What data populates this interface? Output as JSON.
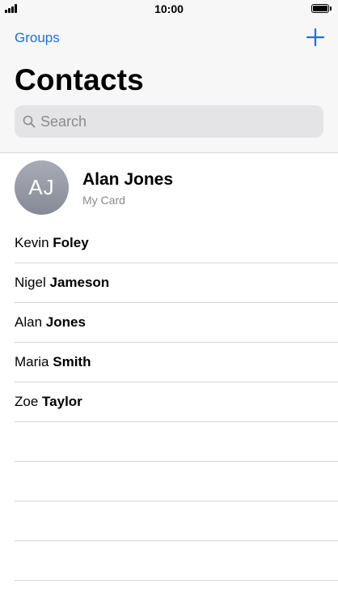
{
  "status_bar": {
    "time": "10:00"
  },
  "nav": {
    "groups_label": "Groups",
    "add_icon": "plus-icon"
  },
  "title": "Contacts",
  "search": {
    "placeholder": "Search",
    "icon": "magnifier-icon"
  },
  "my_card": {
    "initials": "AJ",
    "name": "Alan Jones",
    "subtitle": "My Card"
  },
  "contacts": [
    {
      "first": "Kevin",
      "last": "Foley"
    },
    {
      "first": "Nigel",
      "last": "Jameson"
    },
    {
      "first": "Alan",
      "last": "Jones"
    },
    {
      "first": "Maria",
      "last": "Smith"
    },
    {
      "first": "Zoe",
      "last": "Taylor"
    }
  ],
  "colors": {
    "accent": "#1a6fe0",
    "header_bg": "#f7f7f7",
    "search_bg": "#e4e4e6",
    "secondary_text": "#8a8a8f"
  }
}
